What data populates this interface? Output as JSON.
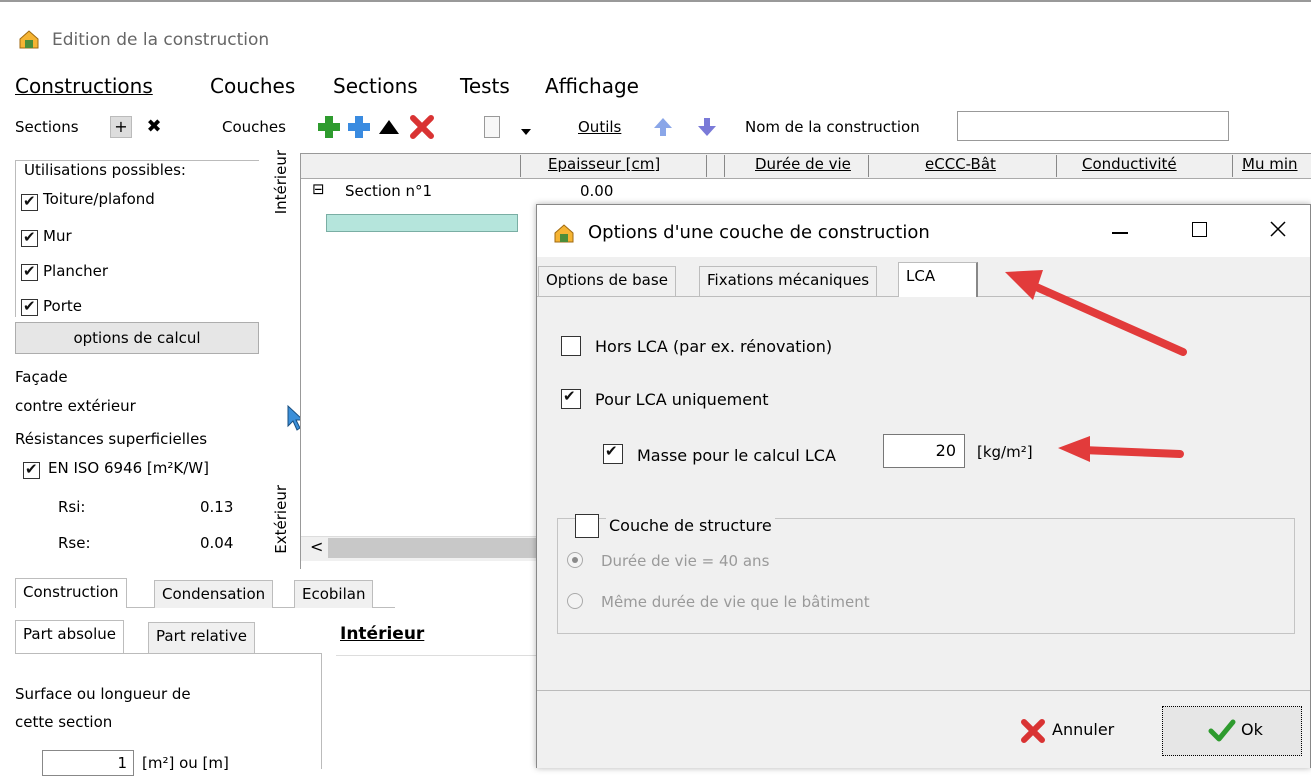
{
  "window": {
    "title": "Edition de la construction"
  },
  "menu": [
    "Constructions",
    "Couches",
    "Sections",
    "Tests",
    "Affichage"
  ],
  "toolbar": {
    "sections_label": "Sections",
    "couches_label": "Couches",
    "outils_label": "Outils",
    "nom_label": "Nom de la construction",
    "nom_value": ""
  },
  "left": {
    "group_title": "Utilisations possibles:",
    "uses": [
      {
        "label": "Toiture/plafond",
        "checked": true
      },
      {
        "label": "Mur",
        "checked": true
      },
      {
        "label": "Plancher",
        "checked": true
      },
      {
        "label": "Porte",
        "checked": true
      }
    ],
    "calc_button": "options de calcul",
    "facade_1": "Façade",
    "facade_2": "contre extérieur",
    "resistances_title": "Résistances superficielles",
    "en_iso": "EN ISO 6946 [m²K/W]",
    "rsi_label": "Rsi:",
    "rsi_value": "0.13",
    "rse_label": "Rse:",
    "rse_value": "0.04",
    "interieur_vertical": "Intérieur",
    "exterieur_vertical": "Extérieur"
  },
  "grid": {
    "columns": [
      "Epaisseur [cm]",
      "Durée de vie",
      "eCCC-Bât",
      "Conductivité",
      "Mu min"
    ],
    "section_label": "Section n°1",
    "section_value": "0.00",
    "expander": "⊟"
  },
  "bottom_tabs": [
    "Construction",
    "Condensation",
    "Ecobilan"
  ],
  "sub_tabs": [
    "Part absolue",
    "Part relative"
  ],
  "interieur_heading": "Intérieur",
  "surface_label_1": "Surface ou longueur de",
  "surface_label_2": "cette section",
  "surface_value": "1",
  "surface_unit": "[m²] ou [m]",
  "dialog": {
    "title": "Options d'une couche de construction",
    "tabs": [
      "Options de base",
      "Fixations mécaniques",
      "LCA"
    ],
    "hors_lca": "Hors LCA (par ex. rénovation)",
    "pour_lca": "Pour LCA uniquement",
    "masse_label": "Masse pour le calcul LCA",
    "masse_value": "20",
    "masse_unit": "[kg/m²]",
    "structure_label": "Couche de structure",
    "radio1": "Durée de vie = 40 ans",
    "radio2": "Même durée de vie que le bâtiment",
    "cancel": "Annuler",
    "ok": "Ok"
  },
  "colors": {
    "accent_green": "#2e9b2e",
    "accent_blue": "#3a8be0",
    "red": "#d93333",
    "arrow_red": "#e23b3b"
  }
}
